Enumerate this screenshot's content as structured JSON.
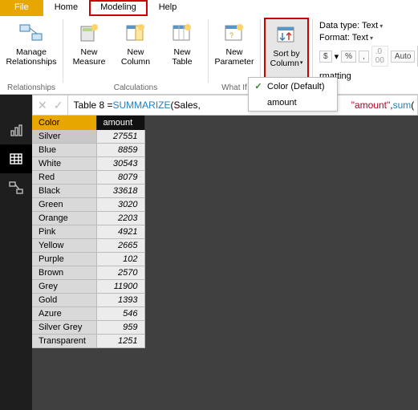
{
  "menu": {
    "file": "File",
    "home": "Home",
    "modeling": "Modeling",
    "help": "Help"
  },
  "ribbon": {
    "manage_rel": "Manage\nRelationships",
    "new_measure": "New\nMeasure",
    "new_column": "New\nColumn",
    "new_table": "New\nTable",
    "new_parameter": "New\nParameter",
    "sort_by": "Sort by\nColumn",
    "groups": {
      "relationships": "Relationships",
      "calculations": "Calculations",
      "whatif": "What If",
      "rmatting": "rmatting"
    },
    "datatype_label": "Data type: ",
    "datatype_val": "Text",
    "format_label": "Format: ",
    "format_val": "Text",
    "currency": "$",
    "pct": "%",
    "comma": ",",
    "auto": "Auto"
  },
  "dropdown": {
    "opt_default": "Color (Default)",
    "opt_amount": "amount"
  },
  "formula": {
    "lhs": "Table 8 = ",
    "fn": "SUMMARIZE",
    "arg1": "Sales",
    "argq": "\"amount\"",
    "tail": ", ",
    "sumfn": "sum"
  },
  "table": {
    "col_color": "Color",
    "col_amount": "amount",
    "rows": [
      {
        "c": "Silver",
        "a": "27551"
      },
      {
        "c": "Blue",
        "a": "8859"
      },
      {
        "c": "White",
        "a": "30543"
      },
      {
        "c": "Red",
        "a": "8079"
      },
      {
        "c": "Black",
        "a": "33618"
      },
      {
        "c": "Green",
        "a": "3020"
      },
      {
        "c": "Orange",
        "a": "2203"
      },
      {
        "c": "Pink",
        "a": "4921"
      },
      {
        "c": "Yellow",
        "a": "2665"
      },
      {
        "c": "Purple",
        "a": "102"
      },
      {
        "c": "Brown",
        "a": "2570"
      },
      {
        "c": "Grey",
        "a": "11900"
      },
      {
        "c": "Gold",
        "a": "1393"
      },
      {
        "c": "Azure",
        "a": "546"
      },
      {
        "c": "Silver Grey",
        "a": "959"
      },
      {
        "c": "Transparent",
        "a": "1251"
      }
    ]
  }
}
